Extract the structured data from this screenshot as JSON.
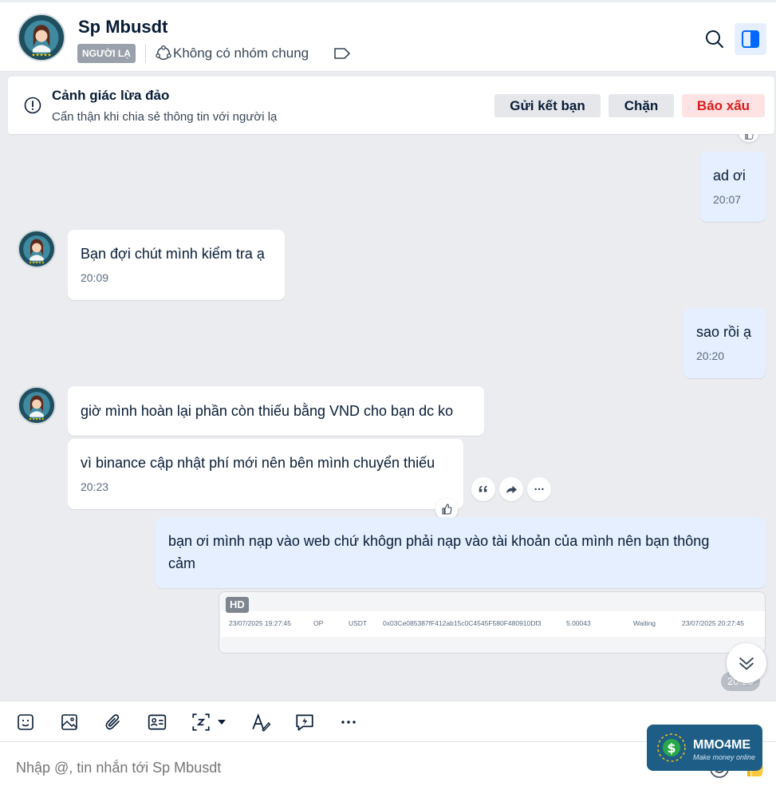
{
  "header": {
    "contact_name": "Sp Mbusdt",
    "stranger_badge": "NGƯỜI LẠ",
    "group_status": "Không có nhóm chung"
  },
  "warning": {
    "title": "Cảnh giác lừa đảo",
    "subtitle": "Cẩn thận khi chia sẻ thông tin với người lạ",
    "add_friend": "Gửi kết bạn",
    "block": "Chặn",
    "report": "Báo xấu"
  },
  "messages": [
    {
      "dir": "out",
      "text": "ad ơi",
      "time": "20:07"
    },
    {
      "dir": "in",
      "text": "Bạn đợi chút mình kiểm tra ạ",
      "time": "20:09"
    },
    {
      "dir": "out",
      "text": "sao rồi ạ",
      "time": "20:20"
    },
    {
      "dir": "in",
      "text": "giờ mình hoàn lại phần còn thiếu bằng VND cho bạn dc ko",
      "time": ""
    },
    {
      "dir": "in",
      "text": "vì binance cập nhật phí mới nên bên mình chuyển thiếu",
      "time": "20:23"
    },
    {
      "dir": "out",
      "text_line1": "bạn ơi mình nạp vào web chứ khôgn phải nạp vào tài khoản của mình nên bạn thông",
      "text_line2": "cảm",
      "time": ""
    }
  ],
  "image_message": {
    "hd_label": "HD",
    "row": {
      "created": "23/07/2025 19:27:45",
      "network": "OP",
      "coin": "USDT",
      "address": "0x03Ce085387fF412ab15c0C4545F580F480910Df3",
      "amount": "5.00043",
      "status": "Waiting",
      "updated": "23/07/2025 20:27:45"
    },
    "time": "20:25"
  },
  "composer": {
    "placeholder": "Nhập @, tin nhắn tới Sp Mbusdt"
  },
  "watermark": {
    "name": "MMO4ME",
    "tagline": "Make money online"
  },
  "colors": {
    "accent": "#0068ff",
    "outgoing_bubble": "#e5efff",
    "report_red": "#d91b1b"
  }
}
